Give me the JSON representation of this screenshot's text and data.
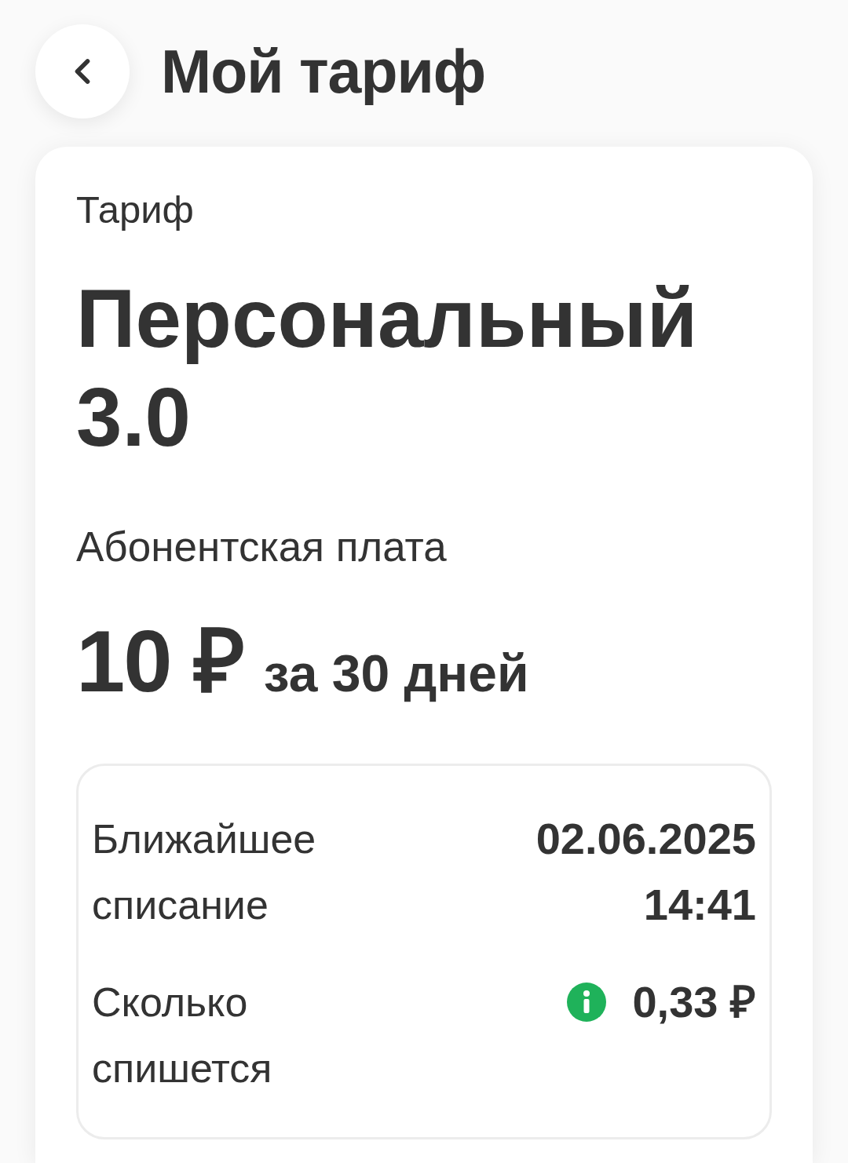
{
  "header": {
    "title": "Мой тариф"
  },
  "tariff": {
    "label": "Тариф",
    "name": "Персональный 3.0",
    "fee_label": "Абонентская плата",
    "price": "10 ₽",
    "period": "за 30 дней",
    "details": [
      {
        "label": "Ближайшее списание",
        "value": "02.06.2025 14:41",
        "info": false
      },
      {
        "label": "Сколько спишется",
        "value": "0,33 ₽",
        "info": true
      }
    ]
  }
}
